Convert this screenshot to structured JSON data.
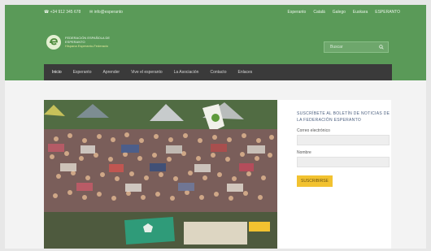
{
  "topbar": {
    "phone": "☎ +34 912 345 678",
    "email": "✉ info@esperanto",
    "links": [
      "Esperanto",
      "Català",
      "Galego",
      "Euskara",
      "ESPERANTO"
    ]
  },
  "header": {
    "org_name": "FEDERACIÓN ESPAÑOLA DE ESPERANTO",
    "org_sub": "Hispana Esperanto-Federacio"
  },
  "search": {
    "placeholder": "Buscar"
  },
  "nav": {
    "items": [
      "Inicio",
      "Esperanto",
      "Aprender",
      "Vive el esperanto",
      "La Asociación",
      "Contacto",
      "Enlaces"
    ]
  },
  "sidebar": {
    "title": "SUSCRÍBETE AL BOLETÍN DE NOTICIAS DE LA FEDERACIÓN ESPERANTO",
    "email_label": "Correo electrónico",
    "name_label": "Nombre",
    "button": "SUSCRIBIRSE"
  },
  "colors": {
    "header": "#5a9a58",
    "nav": "#3a3a3a",
    "button": "#f2c230",
    "title": "#4b5f7f"
  }
}
